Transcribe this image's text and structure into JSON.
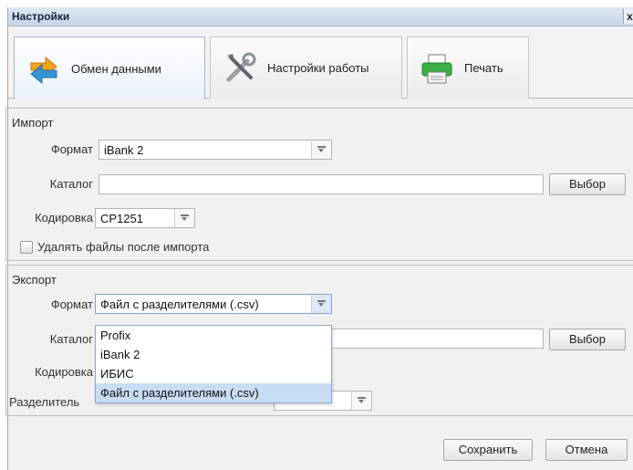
{
  "window": {
    "title": "Настройки",
    "close_label": "x"
  },
  "tabs": [
    {
      "label": "Обмен данными",
      "icon": "exchange-arrows-icon",
      "active": true
    },
    {
      "label": "Настройки работы",
      "icon": "tools-icon",
      "active": false
    },
    {
      "label": "Печать",
      "icon": "printer-icon",
      "active": false
    }
  ],
  "import": {
    "section_title": "Импорт",
    "format_label": "Формат",
    "format_value": "iBank 2",
    "catalog_label": "Каталог",
    "catalog_value": "",
    "choose_label": "Выбор",
    "encoding_label": "Кодировка",
    "encoding_value": "CP1251",
    "delete_files_label": "Удалять файлы после импорта",
    "delete_files_checked": false
  },
  "export": {
    "section_title": "Экспорт",
    "format_label": "Формат",
    "format_value": "Файл с разделителями (.csv)",
    "catalog_label": "Каталог",
    "choose_label": "Выбор",
    "encoding_label": "Кодировка",
    "separator_label": "Разделитель",
    "format_options": [
      "Profix",
      "iBank 2",
      "ИБИС",
      "Файл с разделителями (.csv)"
    ],
    "selected_option": "Файл с разделителями (.csv)"
  },
  "footer": {
    "save_label": "Сохранить",
    "cancel_label": "Отмена"
  },
  "colors": {
    "titlebar": "#c6d5e8",
    "selection": "#c8dcf3",
    "accent": "#7da2ce"
  }
}
